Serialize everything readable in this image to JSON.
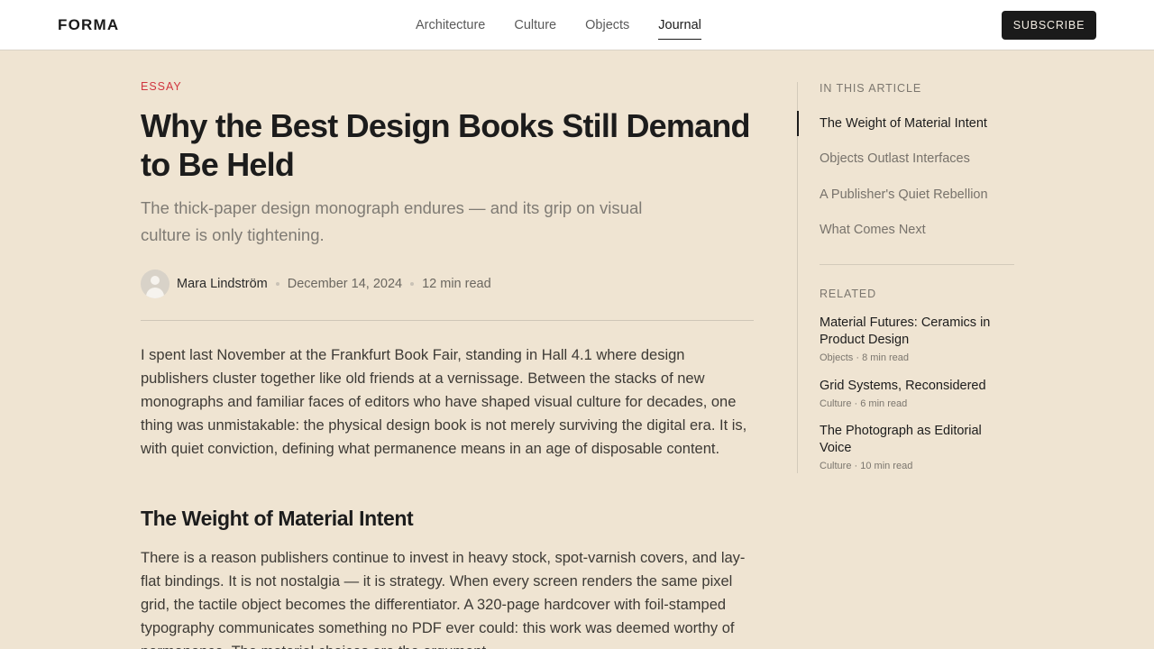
{
  "header": {
    "brand": "FORMA",
    "nav": [
      "Architecture",
      "Culture",
      "Objects",
      "Journal"
    ],
    "active_nav": "Journal",
    "subscribe_label": "SUBSCRIBE"
  },
  "article": {
    "kicker": "ESSAY",
    "title": "Why the Best Design Books Still Demand to Be Held",
    "subtitle": "The thick-paper design monograph endures — and its grip on visual culture is only tightening.",
    "author": "Mara Lindström",
    "date": "December 14, 2024",
    "read_time": "12 min read",
    "paragraph1": "I spent last November at the Frankfurt Book Fair, standing in Hall 4.1 where design publishers cluster together like old friends at a vernissage. Between the stacks of new monographs and familiar faces of editors who have shaped visual culture for decades, one thing was unmistakable: the physical design book is not merely surviving the digital era. It is, with quiet conviction, defining what permanence means in an age of disposable content.",
    "section1_heading": "The Weight of Material Intent",
    "paragraph2": "There is a reason publishers continue to invest in heavy stock, spot-varnish covers, and lay-flat bindings. It is not nostalgia — it is strategy. When every screen renders the same pixel grid, the tactile object becomes the differentiator. A 320-page hardcover with foil-stamped typography communicates something no PDF ever could: this work was deemed worthy of permanence. The material choices are the argument."
  },
  "sidebar": {
    "toc_label": "IN THIS ARTICLE",
    "toc": [
      "The Weight of Material Intent",
      "Objects Outlast Interfaces",
      "A Publisher's Quiet Rebellion",
      "What Comes Next"
    ],
    "toc_active_index": 0,
    "related_label": "RELATED",
    "related": [
      {
        "title": "Material Futures: Ceramics in Product Design",
        "meta": "Objects · 8 min read"
      },
      {
        "title": "Grid Systems, Reconsidered",
        "meta": "Culture · 6 min read"
      },
      {
        "title": "The Photograph as Editorial Voice",
        "meta": "Culture · 10 min read"
      }
    ]
  }
}
